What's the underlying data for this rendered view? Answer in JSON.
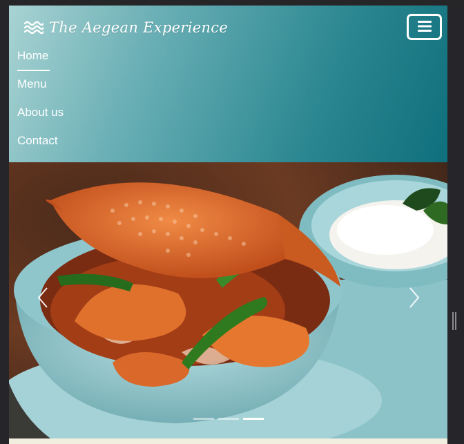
{
  "brand": {
    "name": "The Aegean Experience",
    "icon": "waves-icon"
  },
  "navbar": {
    "toggler_icon": "hamburger-menu-icon",
    "items": [
      {
        "label": "Home",
        "active": true
      },
      {
        "label": "Menu",
        "active": false
      },
      {
        "label": "About us",
        "active": false
      },
      {
        "label": "Contact",
        "active": false
      }
    ]
  },
  "carousel": {
    "prev_icon": "chevron-left-icon",
    "next_icon": "chevron-right-icon",
    "slide_count": 3,
    "active_slide": 3,
    "image_subject": "crab stir-fry in teal bowl with rice"
  },
  "colors": {
    "navbar_gradient_start": "#a9d3d3",
    "navbar_gradient_end": "#0f6f7c",
    "nav_text": "#ffffff",
    "bowl": "#8fc6cc",
    "crab": "#d9682a"
  }
}
